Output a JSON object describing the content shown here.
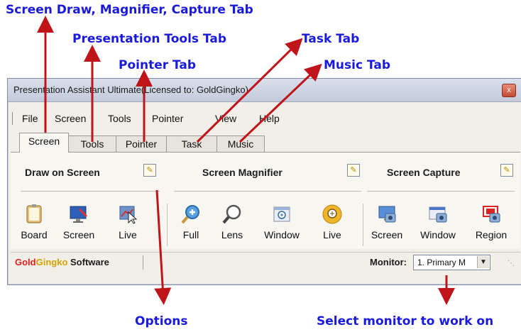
{
  "callouts": {
    "screen_tab": "Screen Draw, Magnifier, Capture Tab",
    "tools_tab": "Presentation Tools Tab",
    "pointer_tab": "Pointer Tab",
    "task_tab": "Task Tab",
    "music_tab": "Music Tab",
    "options": "Options",
    "monitor": "Select monitor to work on"
  },
  "window": {
    "title": "Presentation Assistant Ultimate(Licensed to: GoldGingko)",
    "close_label": "x"
  },
  "menu": [
    "File",
    "Screen",
    "Tools",
    "Pointer",
    "View",
    "Help"
  ],
  "tabs": [
    "Screen",
    "Tools",
    "Pointer",
    "Task",
    "Music"
  ],
  "active_tab": "Screen",
  "groups": {
    "draw": {
      "title": "Draw on Screen",
      "buttons": [
        "Board",
        "Screen",
        "Live"
      ]
    },
    "magnifier": {
      "title": "Screen Magnifier",
      "buttons": [
        "Full",
        "Lens",
        "Window",
        "Live"
      ]
    },
    "capture": {
      "title": "Screen Capture",
      "buttons": [
        "Screen",
        "Window",
        "Region"
      ]
    }
  },
  "status": {
    "brand_part1": "Gold",
    "brand_part2": "Gingko",
    "brand_part3": " Software",
    "monitor_label": "Monitor:",
    "monitor_value": "1. Primary M"
  },
  "colors": {
    "callout_text": "#1a1adf",
    "arrow": "#c0141b",
    "brand_red": "#e02020",
    "brand_gold": "#d7a100"
  }
}
